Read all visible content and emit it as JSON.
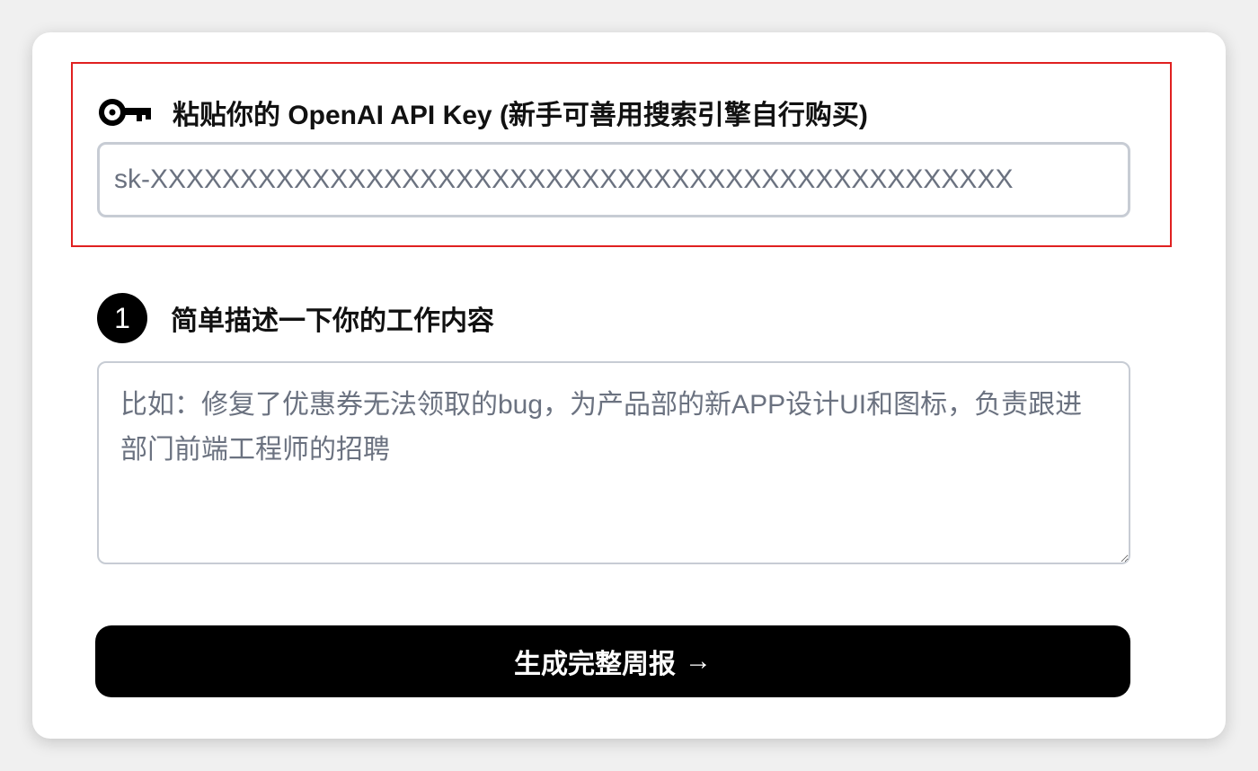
{
  "api_key_section": {
    "icon": "key-icon",
    "label": "粘贴你的 OpenAI API Key (新手可善用搜索引擎自行购买)",
    "input_placeholder": "sk-XXXXXXXXXXXXXXXXXXXXXXXXXXXXXXXXXXXXXXXXXXXXXXXX",
    "input_value": ""
  },
  "step_one": {
    "badge": "1",
    "label": "简单描述一下你的工作内容",
    "textarea_placeholder": "比如：修复了优惠券无法领取的bug，为产品部的新APP设计UI和图标，负责跟进部门前端工程师的招聘",
    "textarea_value": ""
  },
  "submit": {
    "label": "生成完整周报",
    "icon": "arrow-right-icon",
    "arrow": "→"
  },
  "colors": {
    "highlight_border": "#e02020",
    "button_bg": "#000000",
    "button_text": "#ffffff",
    "input_border": "#c7ccd4",
    "placeholder": "#6b7280"
  }
}
